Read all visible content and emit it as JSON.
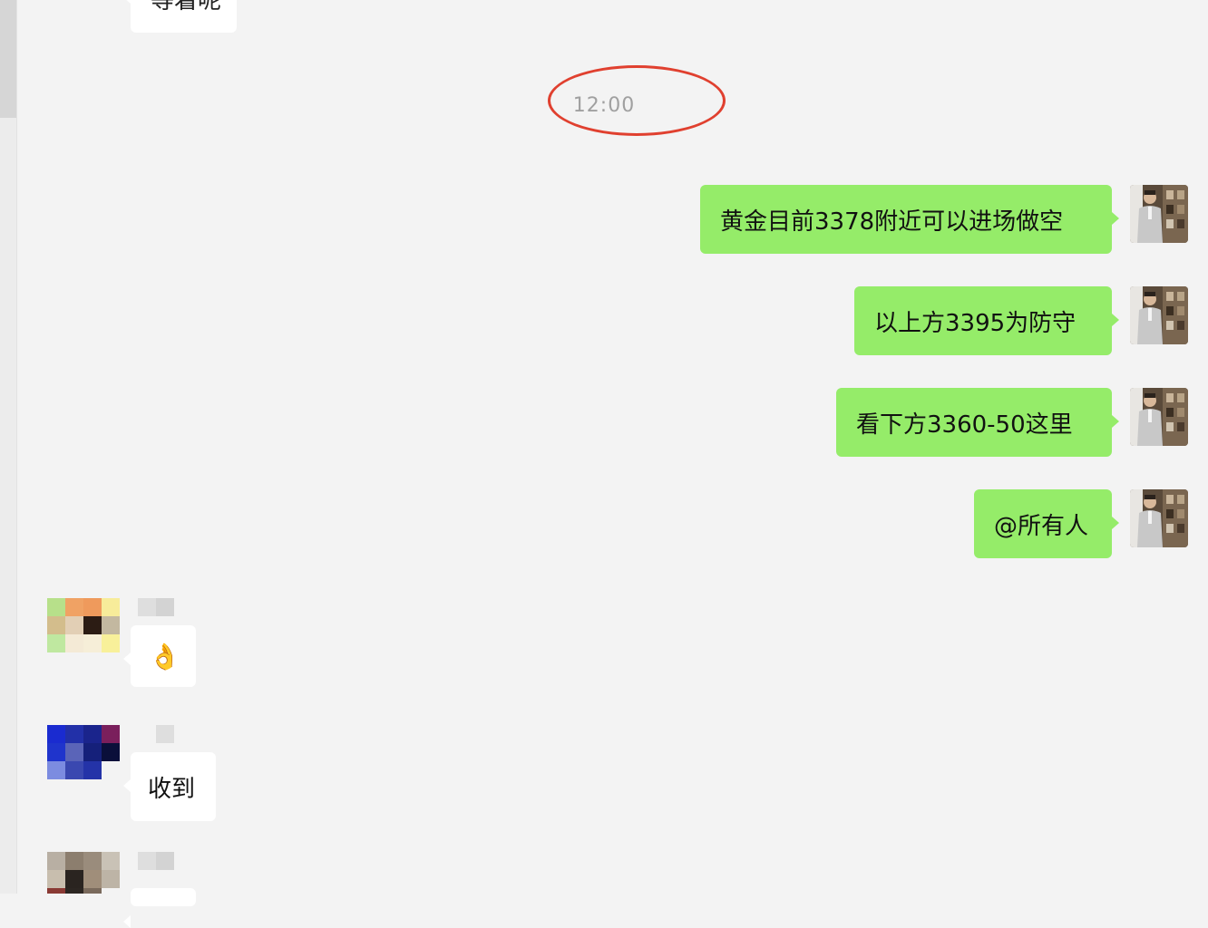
{
  "chat": {
    "top_partial_message": "等着呢",
    "timestamp": "12:00",
    "my_messages": [
      "黄金目前3378附近可以进场做空",
      "以上方3395为防守",
      "看下方3360-50这里",
      "@所有人"
    ],
    "other_messages": [
      "👌",
      "收到"
    ]
  },
  "colors": {
    "my_bubble": "#95ec69",
    "other_bubble": "#ffffff",
    "background": "#f3f3f3",
    "highlight_ellipse": "#e0402f"
  }
}
